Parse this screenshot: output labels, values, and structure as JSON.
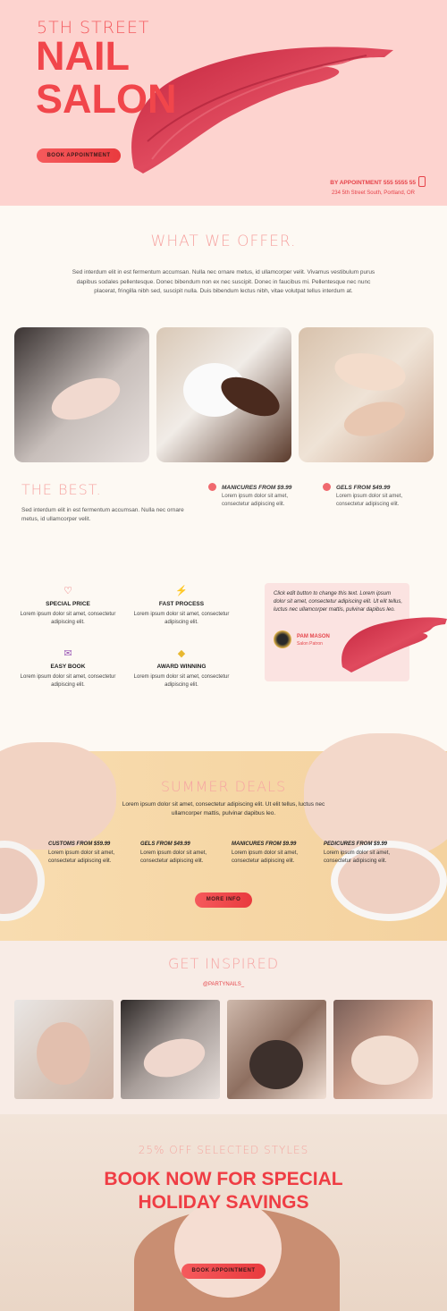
{
  "hero": {
    "kicker": "5TH STREET",
    "title_line1": "NAIL",
    "title_line2": "SALON",
    "cta": "BOOK APPOINTMENT",
    "appointment": "BY APPOINTMENT 555 5555 55",
    "address": "234 5th Street South, Portland, OR"
  },
  "offer": {
    "title": "WHAT WE OFFER.",
    "text": "Sed interdum elit in est fermentum accumsan. Nulla nec ornare metus, id ullamcorper velit. Vivamus vestibulum purus dapibus sodales pellentesque. Donec bibendum non ex nec suscipit. Donec in faucibus mi. Pellentesque nec nunc placerat, fringilla nibh sed, suscipit nulla. Duis bibendum lectus nibh, vitae volutpat tellus interdum at."
  },
  "best": {
    "title": "THE BEST.",
    "text": "Sed interdum elit in est fermentum accumsan. Nulla nec ornare metus, id ullamcorper velit.",
    "items": [
      {
        "title": "MANICURES FROM $9.99",
        "text": "Lorem ipsum dolor sit amet, consectetur adipiscing elit."
      },
      {
        "title": "GELS FROM $49.99",
        "text": "Lorem ipsum dolor sit amet, consectetur adipiscing elit."
      }
    ]
  },
  "features": [
    {
      "icon": "heart-icon",
      "title": "SPECIAL PRICE",
      "text": "Lorem ipsum dolor sit amet, consectetur adipiscing elit."
    },
    {
      "icon": "lightning-icon",
      "title": "FAST PROCESS",
      "text": "Lorem ipsum dolor sit amet, consectetur adipiscing elit."
    },
    {
      "icon": "envelope-icon",
      "title": "EASY BOOK",
      "text": "Lorem ipsum dolor sit amet, consectetur adipiscing elit."
    },
    {
      "icon": "diamond-icon",
      "title": "AWARD WINNING",
      "text": "Lorem ipsum dolor sit amet, consectetur adipiscing elit."
    }
  ],
  "testimonial": {
    "quote": "Click edit button to change this text. Lorem ipsum dolor sit amet, consectetur adipiscing elit. Ut elit tellus, luctus nec ullamcorper mattis, pulvinar dapibus leo.",
    "name": "PAM MASON",
    "role": "Salon Patron"
  },
  "summer": {
    "title": "SUMMER DEALS",
    "text": "Lorem ipsum dolor sit amet, consectetur adipiscing elit. Ut elit tellus, luctus nec ullamcorper mattis, pulvinar dapibus leo.",
    "deals": [
      {
        "title": "CUSTOMS FROM $59.99",
        "text": "Lorem ipsum dolor sit amet, consectetur adipiscing elit."
      },
      {
        "title": "GELS FROM $49.99",
        "text": "Lorem ipsum dolor sit amet, consectetur adipiscing elit."
      },
      {
        "title": "MANICURES FROM $9.99",
        "text": "Lorem ipsum dolor sit amet, consectetur adipiscing elit."
      },
      {
        "title": "PEDICURES FROM $9.99",
        "text": "Lorem ipsum dolor sit amet, consectetur adipiscing elit."
      }
    ],
    "cta": "MORE INFO"
  },
  "inspired": {
    "title": "GET INSPIRED",
    "handle": "@PARTYNAILS_"
  },
  "booking": {
    "subtitle": "25% OFF SELECTED STYLES",
    "title": "BOOK NOW FOR SPECIAL HOLIDAY SAVINGS",
    "cta": "BOOK APPOINTMENT"
  },
  "colors": {
    "accent": "#f1464b",
    "hero_bg": "#fdd3cf",
    "page_bg": "#fdf9f3"
  }
}
